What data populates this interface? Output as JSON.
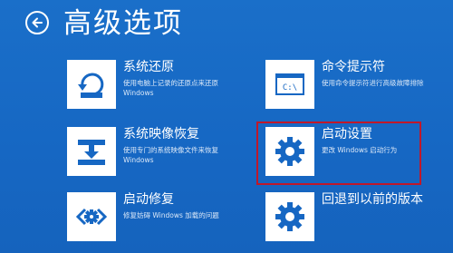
{
  "header": {
    "back_icon": "back-arrow-icon",
    "title": "高级选项"
  },
  "options": [
    {
      "id": "system-restore",
      "name": "系统还原",
      "desc": "使用电脑上记录的还原点来还原 Windows",
      "icon": "system-restore-icon"
    },
    {
      "id": "command-prompt",
      "name": "命令提示符",
      "desc": "使用命令提示符进行高级故障排除",
      "icon": "command-prompt-icon",
      "icon_text": "C:\\"
    },
    {
      "id": "system-image-recovery",
      "name": "系统映像恢复",
      "desc": "使用专门的系统映像文件来恢复 Windows",
      "icon": "system-image-icon"
    },
    {
      "id": "startup-settings",
      "name": "启动设置",
      "desc": "更改 Windows 启动行为",
      "icon": "gear-icon",
      "highlighted": true
    },
    {
      "id": "startup-repair",
      "name": "启动修复",
      "desc": "修复妨碍 Windows 加载的问题",
      "icon": "startup-repair-icon"
    },
    {
      "id": "go-back",
      "name": "回退到以前的版本",
      "desc": "",
      "icon": "gear-icon"
    }
  ],
  "colors": {
    "background": "#1667c3",
    "icon_tile": "#ffffff",
    "icon_glyph": "#1667c3",
    "highlight": "#c0182a"
  }
}
